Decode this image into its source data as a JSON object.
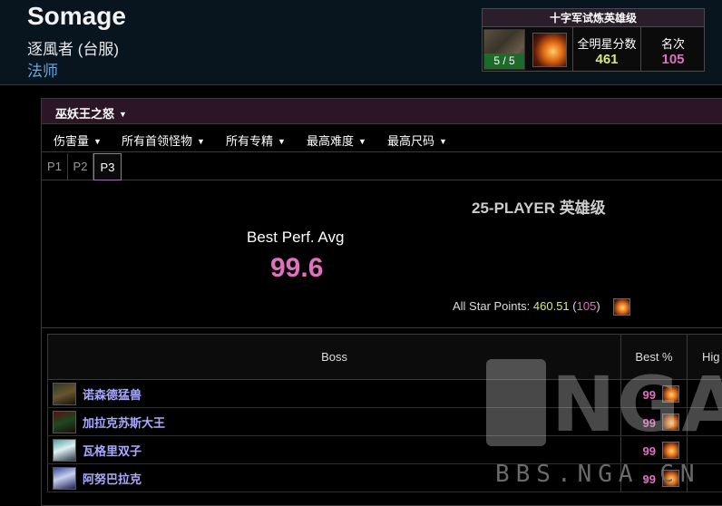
{
  "player": {
    "name": "Somage",
    "server": "逐風者 (台服)",
    "class": "法师"
  },
  "raid_summary": {
    "title": "十字军试炼英雄级",
    "kills": "5 / 5",
    "allstar_label": "全明星分数",
    "allstar_value": "461",
    "rank_label": "名次",
    "rank_value": "105"
  },
  "zone": {
    "label": "巫妖王之怒"
  },
  "filters": [
    {
      "label": "伤害量"
    },
    {
      "label": "所有首领怪物"
    },
    {
      "label": "所有专精"
    },
    {
      "label": "最高难度"
    },
    {
      "label": "最高尺码"
    }
  ],
  "partitions": [
    {
      "label": "P1",
      "active": false
    },
    {
      "label": "P2",
      "active": false
    },
    {
      "label": "P3",
      "active": true
    }
  ],
  "summary": {
    "difficulty_title": "25-PLAYER 英雄级",
    "perf_label": "Best Perf. Avg",
    "perf_value": "99.6",
    "asp_label": "All Star Points:",
    "asp_points": "460.51",
    "asp_rank": "105"
  },
  "table": {
    "headers": {
      "boss": "Boss",
      "best": "Best %",
      "high": "Hig"
    },
    "rows": [
      {
        "boss": "诺森德猛兽",
        "best": "99"
      },
      {
        "boss": "加拉克苏斯大王",
        "best": "99"
      },
      {
        "boss": "瓦格里双子",
        "best": "99"
      },
      {
        "boss": "阿努巴拉克",
        "best": "99"
      }
    ]
  },
  "watermark": {
    "logo_text": "NGA",
    "url": "BBS.NGA.CN"
  },
  "colors": {
    "accent_pink": "#e26fbf",
    "allstar_yellow": "#d8e87a",
    "class_blue": "#69a7e0",
    "boss_link": "#a9a9ff",
    "zone_bar": "#2c1626"
  },
  "icons": {
    "raid_icon": "fire-spell-icon",
    "best_icon": "fire-spell-icon"
  }
}
